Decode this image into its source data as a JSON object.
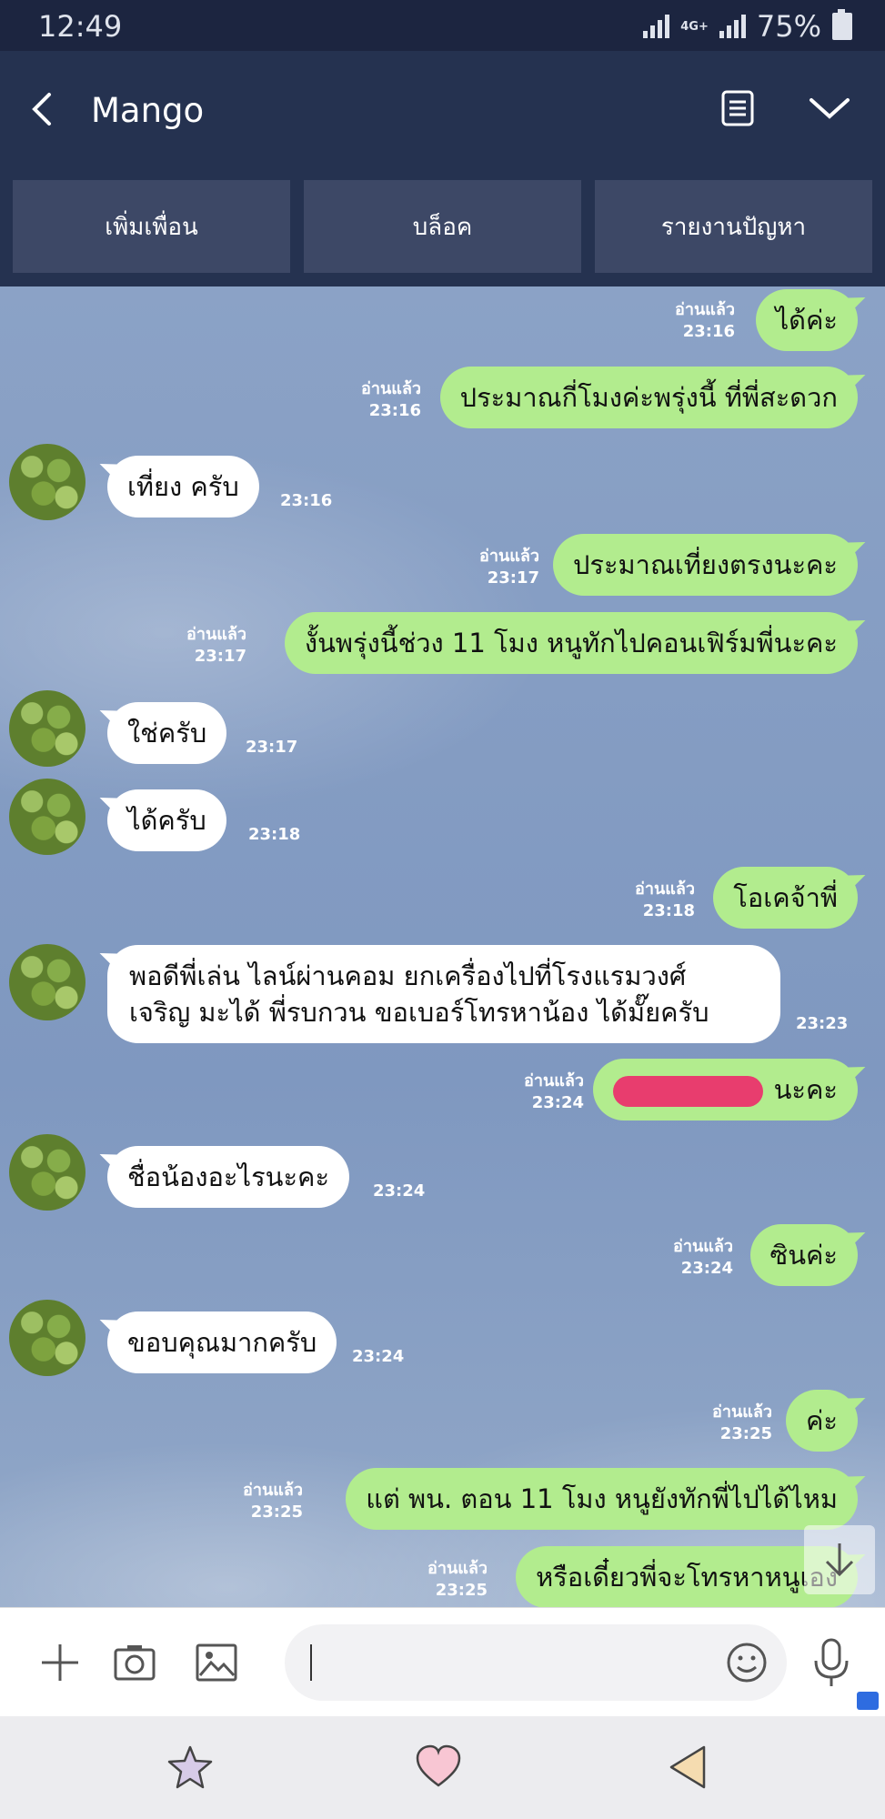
{
  "status_bar": {
    "time": "12:49",
    "network": "4G+",
    "battery": "75%"
  },
  "header": {
    "title": "Mango",
    "actions": [
      "เพิ่มเพื่อน",
      "บล็อค",
      "รายงานปัญหา"
    ]
  },
  "messages": [
    {
      "side": "out",
      "text": "ได้ค่ะ",
      "read": "อ่านแล้ว",
      "time": "23:16"
    },
    {
      "side": "out",
      "text": "ประมาณกี่โมงค่ะพรุ่งนี้ ที่พี่สะดวก",
      "read": "อ่านแล้ว",
      "time": "23:16"
    },
    {
      "side": "in",
      "text": "เที่ยง ครับ",
      "time": "23:16"
    },
    {
      "side": "out",
      "text": "ประมาณเที่ยงตรงนะคะ",
      "read": "อ่านแล้ว",
      "time": "23:17"
    },
    {
      "side": "out",
      "text": "งั้นพรุ่งนี้ช่วง 11 โมง หนูทักไปคอนเฟิร์มพี่นะคะ",
      "read": "อ่านแล้ว",
      "time": "23:17"
    },
    {
      "side": "in",
      "text": "ใช่ครับ",
      "time": "23:17"
    },
    {
      "side": "in",
      "text": "ได้ครับ",
      "time": "23:18"
    },
    {
      "side": "out",
      "text": "โอเคจ้าพี่",
      "read": "อ่านแล้ว",
      "time": "23:18"
    },
    {
      "side": "in",
      "text_line1": "พอดีพี่เล่น ไลน์ผ่านคอม ยกเครื่องไปที่โรงแรมวงศ์",
      "text_line2": "เจริญ มะได้ พี่รบกวน ขอเบอร์โทรหาน้อง ได้มั๊ยครับ",
      "time": "23:23"
    },
    {
      "side": "out",
      "text": "นะคะ",
      "read": "อ่านแล้ว",
      "time": "23:24"
    },
    {
      "side": "in",
      "text": "ชื่อน้องอะไรนะคะ",
      "time": "23:24"
    },
    {
      "side": "out",
      "text": "ซินค่ะ",
      "read": "อ่านแล้ว",
      "time": "23:24"
    },
    {
      "side": "in",
      "text": "ขอบคุณมากครับ",
      "time": "23:24"
    },
    {
      "side": "out",
      "text": "ค่ะ",
      "read": "อ่านแล้ว",
      "time": "23:25"
    },
    {
      "side": "out",
      "text": "แต่ พน. ตอน 11 โมง หนูยังทักพี่ไปได้ไหม",
      "read": "อ่านแล้ว",
      "time": "23:25"
    },
    {
      "side": "out",
      "text": "หรือเดี๋ยวพี่จะโทรหาหนูเอง",
      "read": "อ่านแล้ว",
      "time": "23:25"
    }
  ],
  "input": {
    "placeholder": ""
  },
  "icons": [
    "back-icon",
    "notes-icon",
    "chevron-down-icon",
    "plus-icon",
    "camera-icon",
    "image-icon",
    "emoji-icon",
    "mic-icon",
    "star-icon",
    "heart-icon",
    "triangle-back-icon",
    "arrow-down-icon"
  ],
  "colors": {
    "header": "#253250",
    "outgoing": "#b2ec8e",
    "incoming": "#ffffff",
    "redaction": "#e83d6e"
  }
}
